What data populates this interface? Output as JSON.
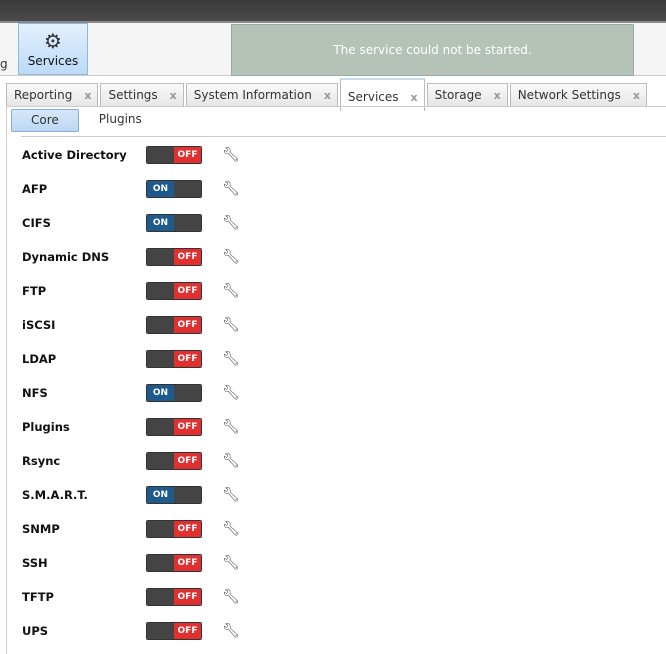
{
  "toolbar": {
    "partial_label": "g",
    "services_label": "Services",
    "notice": "The service could not be started."
  },
  "tabs": [
    {
      "label": "Reporting"
    },
    {
      "label": "Settings"
    },
    {
      "label": "System Information"
    },
    {
      "label": "Services",
      "active": true
    },
    {
      "label": "Storage"
    },
    {
      "label": "Network Settings"
    }
  ],
  "tab_close": "x",
  "subtabs": [
    {
      "label": "Core"
    },
    {
      "label": "Plugins"
    }
  ],
  "colors": {
    "on": "#1e5a8c",
    "off": "#e03030",
    "knob": "#444"
  },
  "toggle_on": "ON",
  "toggle_off": "OFF",
  "services": [
    {
      "name": "Active Directory",
      "on": false
    },
    {
      "name": "AFP",
      "on": true
    },
    {
      "name": "CIFS",
      "on": true
    },
    {
      "name": "Dynamic DNS",
      "on": false
    },
    {
      "name": "FTP",
      "on": false
    },
    {
      "name": "iSCSI",
      "on": false
    },
    {
      "name": "LDAP",
      "on": false
    },
    {
      "name": "NFS",
      "on": true
    },
    {
      "name": "Plugins",
      "on": false
    },
    {
      "name": "Rsync",
      "on": false
    },
    {
      "name": "S.M.A.R.T.",
      "on": true
    },
    {
      "name": "SNMP",
      "on": false
    },
    {
      "name": "SSH",
      "on": false
    },
    {
      "name": "TFTP",
      "on": false
    },
    {
      "name": "UPS",
      "on": false
    }
  ]
}
